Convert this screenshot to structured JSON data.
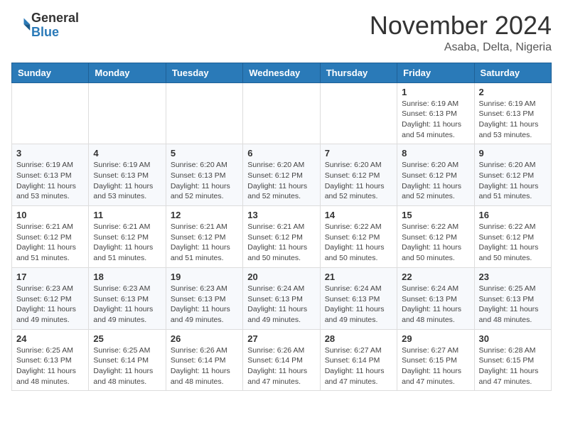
{
  "header": {
    "logo": {
      "general": "General",
      "blue": "Blue"
    },
    "title": "November 2024",
    "location": "Asaba, Delta, Nigeria"
  },
  "calendar": {
    "weekdays": [
      "Sunday",
      "Monday",
      "Tuesday",
      "Wednesday",
      "Thursday",
      "Friday",
      "Saturday"
    ],
    "weeks": [
      [
        {
          "day": "",
          "sunrise": "",
          "sunset": "",
          "daylight": ""
        },
        {
          "day": "",
          "sunrise": "",
          "sunset": "",
          "daylight": ""
        },
        {
          "day": "",
          "sunrise": "",
          "sunset": "",
          "daylight": ""
        },
        {
          "day": "",
          "sunrise": "",
          "sunset": "",
          "daylight": ""
        },
        {
          "day": "",
          "sunrise": "",
          "sunset": "",
          "daylight": ""
        },
        {
          "day": "1",
          "sunrise": "Sunrise: 6:19 AM",
          "sunset": "Sunset: 6:13 PM",
          "daylight": "Daylight: 11 hours and 54 minutes."
        },
        {
          "day": "2",
          "sunrise": "Sunrise: 6:19 AM",
          "sunset": "Sunset: 6:13 PM",
          "daylight": "Daylight: 11 hours and 53 minutes."
        }
      ],
      [
        {
          "day": "3",
          "sunrise": "Sunrise: 6:19 AM",
          "sunset": "Sunset: 6:13 PM",
          "daylight": "Daylight: 11 hours and 53 minutes."
        },
        {
          "day": "4",
          "sunrise": "Sunrise: 6:19 AM",
          "sunset": "Sunset: 6:13 PM",
          "daylight": "Daylight: 11 hours and 53 minutes."
        },
        {
          "day": "5",
          "sunrise": "Sunrise: 6:20 AM",
          "sunset": "Sunset: 6:13 PM",
          "daylight": "Daylight: 11 hours and 52 minutes."
        },
        {
          "day": "6",
          "sunrise": "Sunrise: 6:20 AM",
          "sunset": "Sunset: 6:12 PM",
          "daylight": "Daylight: 11 hours and 52 minutes."
        },
        {
          "day": "7",
          "sunrise": "Sunrise: 6:20 AM",
          "sunset": "Sunset: 6:12 PM",
          "daylight": "Daylight: 11 hours and 52 minutes."
        },
        {
          "day": "8",
          "sunrise": "Sunrise: 6:20 AM",
          "sunset": "Sunset: 6:12 PM",
          "daylight": "Daylight: 11 hours and 52 minutes."
        },
        {
          "day": "9",
          "sunrise": "Sunrise: 6:20 AM",
          "sunset": "Sunset: 6:12 PM",
          "daylight": "Daylight: 11 hours and 51 minutes."
        }
      ],
      [
        {
          "day": "10",
          "sunrise": "Sunrise: 6:21 AM",
          "sunset": "Sunset: 6:12 PM",
          "daylight": "Daylight: 11 hours and 51 minutes."
        },
        {
          "day": "11",
          "sunrise": "Sunrise: 6:21 AM",
          "sunset": "Sunset: 6:12 PM",
          "daylight": "Daylight: 11 hours and 51 minutes."
        },
        {
          "day": "12",
          "sunrise": "Sunrise: 6:21 AM",
          "sunset": "Sunset: 6:12 PM",
          "daylight": "Daylight: 11 hours and 51 minutes."
        },
        {
          "day": "13",
          "sunrise": "Sunrise: 6:21 AM",
          "sunset": "Sunset: 6:12 PM",
          "daylight": "Daylight: 11 hours and 50 minutes."
        },
        {
          "day": "14",
          "sunrise": "Sunrise: 6:22 AM",
          "sunset": "Sunset: 6:12 PM",
          "daylight": "Daylight: 11 hours and 50 minutes."
        },
        {
          "day": "15",
          "sunrise": "Sunrise: 6:22 AM",
          "sunset": "Sunset: 6:12 PM",
          "daylight": "Daylight: 11 hours and 50 minutes."
        },
        {
          "day": "16",
          "sunrise": "Sunrise: 6:22 AM",
          "sunset": "Sunset: 6:12 PM",
          "daylight": "Daylight: 11 hours and 50 minutes."
        }
      ],
      [
        {
          "day": "17",
          "sunrise": "Sunrise: 6:23 AM",
          "sunset": "Sunset: 6:12 PM",
          "daylight": "Daylight: 11 hours and 49 minutes."
        },
        {
          "day": "18",
          "sunrise": "Sunrise: 6:23 AM",
          "sunset": "Sunset: 6:13 PM",
          "daylight": "Daylight: 11 hours and 49 minutes."
        },
        {
          "day": "19",
          "sunrise": "Sunrise: 6:23 AM",
          "sunset": "Sunset: 6:13 PM",
          "daylight": "Daylight: 11 hours and 49 minutes."
        },
        {
          "day": "20",
          "sunrise": "Sunrise: 6:24 AM",
          "sunset": "Sunset: 6:13 PM",
          "daylight": "Daylight: 11 hours and 49 minutes."
        },
        {
          "day": "21",
          "sunrise": "Sunrise: 6:24 AM",
          "sunset": "Sunset: 6:13 PM",
          "daylight": "Daylight: 11 hours and 49 minutes."
        },
        {
          "day": "22",
          "sunrise": "Sunrise: 6:24 AM",
          "sunset": "Sunset: 6:13 PM",
          "daylight": "Daylight: 11 hours and 48 minutes."
        },
        {
          "day": "23",
          "sunrise": "Sunrise: 6:25 AM",
          "sunset": "Sunset: 6:13 PM",
          "daylight": "Daylight: 11 hours and 48 minutes."
        }
      ],
      [
        {
          "day": "24",
          "sunrise": "Sunrise: 6:25 AM",
          "sunset": "Sunset: 6:13 PM",
          "daylight": "Daylight: 11 hours and 48 minutes."
        },
        {
          "day": "25",
          "sunrise": "Sunrise: 6:25 AM",
          "sunset": "Sunset: 6:14 PM",
          "daylight": "Daylight: 11 hours and 48 minutes."
        },
        {
          "day": "26",
          "sunrise": "Sunrise: 6:26 AM",
          "sunset": "Sunset: 6:14 PM",
          "daylight": "Daylight: 11 hours and 48 minutes."
        },
        {
          "day": "27",
          "sunrise": "Sunrise: 6:26 AM",
          "sunset": "Sunset: 6:14 PM",
          "daylight": "Daylight: 11 hours and 47 minutes."
        },
        {
          "day": "28",
          "sunrise": "Sunrise: 6:27 AM",
          "sunset": "Sunset: 6:14 PM",
          "daylight": "Daylight: 11 hours and 47 minutes."
        },
        {
          "day": "29",
          "sunrise": "Sunrise: 6:27 AM",
          "sunset": "Sunset: 6:15 PM",
          "daylight": "Daylight: 11 hours and 47 minutes."
        },
        {
          "day": "30",
          "sunrise": "Sunrise: 6:28 AM",
          "sunset": "Sunset: 6:15 PM",
          "daylight": "Daylight: 11 hours and 47 minutes."
        }
      ]
    ]
  }
}
